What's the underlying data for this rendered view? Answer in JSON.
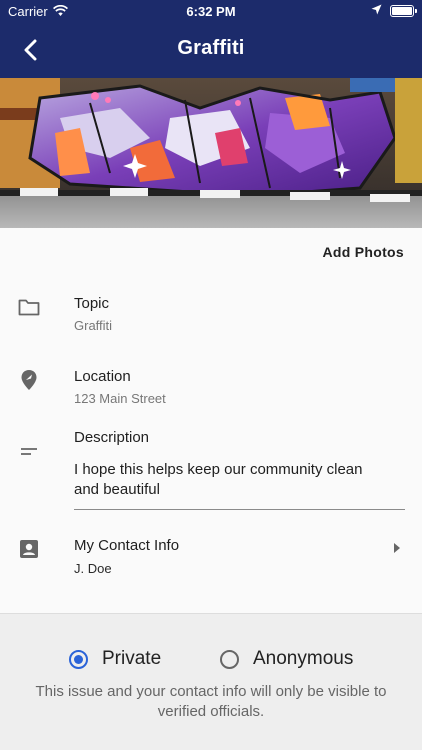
{
  "status_bar": {
    "carrier": "Carrier",
    "time": "6:32 PM"
  },
  "nav": {
    "title": "Graffiti"
  },
  "photos": {
    "add_label": "Add Photos"
  },
  "fields": {
    "topic": {
      "label": "Topic",
      "value": "Graffiti",
      "icon": "folder-icon"
    },
    "location": {
      "label": "Location",
      "value": "123 Main Street",
      "icon": "location-pin-icon"
    },
    "description": {
      "label": "Description",
      "value": "I hope this helps keep our community clean and beautiful",
      "icon": "short-text-icon"
    },
    "contact": {
      "label": "My Contact Info",
      "value": "J. Doe",
      "icon": "contact-card-icon"
    }
  },
  "privacy": {
    "options": [
      "Private",
      "Anonymous"
    ],
    "selected": "Private",
    "note": "This issue and your contact info will only be visible to verified officials."
  },
  "colors": {
    "nav_bg": "#1c2b6b",
    "accent": "#2a63d8"
  }
}
